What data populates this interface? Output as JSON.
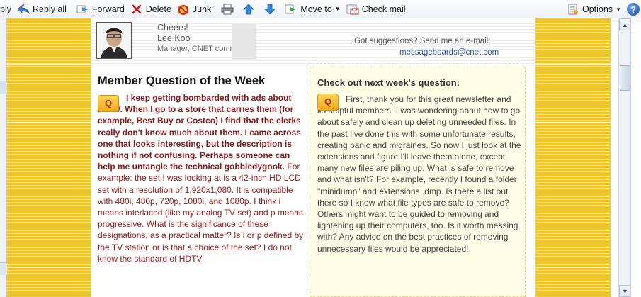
{
  "toolbar": {
    "reply": "ply",
    "reply_all": "Reply all",
    "forward": "Forward",
    "delete": "Delete",
    "junk": "Junk",
    "move_to": "Move to",
    "check_mail": "Check mail",
    "options": "Options",
    "help": "?"
  },
  "header": {
    "greeting": "Cheers!",
    "name": "Lee Koo",
    "role": "Manager, CNET community",
    "suggest": "Got suggestions? Send me an e-mail:",
    "email": "messageboards@cnet.com"
  },
  "question": {
    "title": "Member Question of the Week",
    "badge": "Q",
    "bold_text": "I keep getting bombarded with ads about HDTV. When I go to a store that carries them (for example, Best Buy or Costco) I find that the clerks really don't know much about them. I came across one that looks interesting, but the description is nothing if not confusing. Perhaps someone can help me untangle the technical gobbledygook.",
    "normal_text": " For example: the set I was looking at is a 42-inch HD LCD set with a resolution of 1,920x1,080. It is compatible with 480i, 480p, 720p, 1080i, and 1080p. I think i means interlaced (like my analog TV set) and p means progressive. What is the significance of these designations, as a practical matter? Is i or p defined by the TV station or is that a choice of the set? I do not know the standard of HDTV"
  },
  "next_week": {
    "title": "Check out next week's question:",
    "badge": "Q",
    "text": "First, thank you for this great newsletter and its helpful members. I was wondering about how to go about safely and clean up deleting unneeded files. In the past I've done this with some unfortunate results, creating panic and migraines. So now I just look at the extensions and figure I'll leave them alone, except many new files are piling up. What is safe to remove and what isn't? For example, recently I found a folder \"minidump\" and extensions .dmp. Is there a list out there so I know what file types are safe to remove? Others might want to be guided to removing and lightening up their computers, too. Is it worth messing with? Any advice on the best practices of removing unnecessary files would be appreciated!"
  },
  "colors": {
    "accent_yellow": "#f7c519",
    "question_red": "#8b1a1a",
    "link_blue": "#2b53c8"
  }
}
